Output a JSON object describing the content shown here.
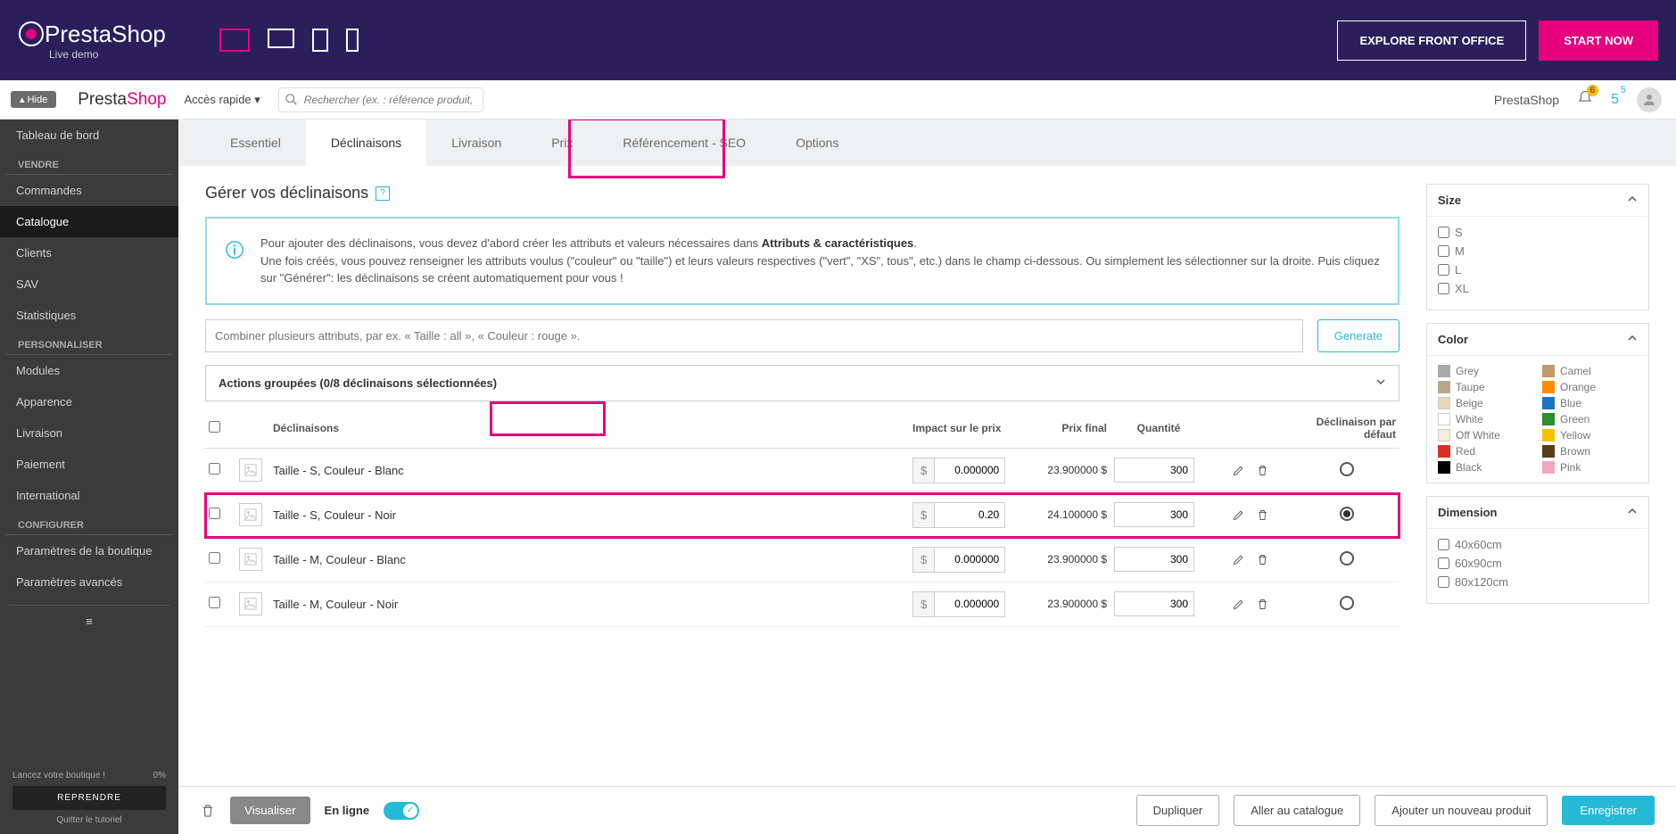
{
  "top_bar": {
    "logo_text": "PrestaShop",
    "logo_sub": "Live demo",
    "explore_btn": "EXPLORE FRONT OFFICE",
    "start_btn": "START NOW"
  },
  "header": {
    "hide": "Hide",
    "brand_presta": "Presta",
    "brand_shop": "Shop",
    "quick_access": "Accès rapide",
    "search_placeholder": "Rechercher (ex. : référence produit, nom...)",
    "shop_name": "PrestaShop",
    "notif_count": "6",
    "msg_count": "5"
  },
  "sidebar": {
    "dashboard": "Tableau de bord",
    "sections": {
      "vendre": "VENDRE",
      "personnaliser": "PERSONNALISER",
      "configurer": "CONFIGURER"
    },
    "items": {
      "commandes": "Commandes",
      "catalogue": "Catalogue",
      "clients": "Clients",
      "sav": "SAV",
      "statistiques": "Statistiques",
      "modules": "Modules",
      "apparence": "Apparence",
      "livraison": "Livraison",
      "paiement": "Paiement",
      "international": "International",
      "params_boutique": "Paramètres de la boutique",
      "params_avances": "Paramètres avancés"
    },
    "footer": {
      "launch": "Lancez votre boutique !",
      "pct": "0%",
      "reprendre": "REPRENDRE",
      "quit": "Quitter le tutoriel"
    }
  },
  "tabs": {
    "essentiel": "Essentiel",
    "declinaisons": "Déclinaisons",
    "livraison": "Livraison",
    "prix": "Prix",
    "seo": "Référencement - SEO",
    "options": "Options"
  },
  "content": {
    "title": "Gérer vos déclinaisons",
    "help": "?",
    "info": {
      "line1a": "Pour ajouter des déclinaisons, vous devez d'abord créer les attributs et valeurs nécessaires dans ",
      "line1b": "Attributs & caractéristiques",
      "line2": "Une fois créés, vous pouvez renseigner les attributs voulus (\"couleur\" ou \"taille\") et leurs valeurs respectives (\"vert\", \"XS\", tous\", etc.) dans le champ ci-dessous. Ou simplement les sélectionner sur la droite. Puis cliquez sur \"Générer\": les déclinaisons se créent automatiquement pour vous !"
    },
    "combine_placeholder": "Combiner plusieurs attributs, par ex. « Taille : all », « Couleur : rouge ».",
    "generate_btn": "Generate",
    "grouped_actions": "Actions groupées (0/8 déclinaisons sélectionnées)",
    "columns": {
      "declinaisons": "Déclinaisons",
      "impact": "Impact sur le prix",
      "prix_final": "Prix final",
      "quantite": "Quantité",
      "default": "Déclinaison par défaut"
    },
    "rows": [
      {
        "name": "Taille - S, Couleur - Blanc",
        "impact": "0.000000",
        "final": "23.900000 $",
        "qty": "300",
        "default": false
      },
      {
        "name": "Taille - S, Couleur - Noir",
        "impact": "0.20",
        "final": "24.100000 $",
        "qty": "300",
        "default": true
      },
      {
        "name": "Taille - M, Couleur - Blanc",
        "impact": "0.000000",
        "final": "23.900000 $",
        "qty": "300",
        "default": false
      },
      {
        "name": "Taille - M, Couleur - Noir",
        "impact": "0.000000",
        "final": "23.900000 $",
        "qty": "300",
        "default": false
      }
    ],
    "currency": "$"
  },
  "filters": {
    "size": {
      "title": "Size",
      "options": [
        "S",
        "M",
        "L",
        "XL"
      ]
    },
    "color": {
      "title": "Color",
      "options": [
        {
          "name": "Grey",
          "hex": "#aaa"
        },
        {
          "name": "Camel",
          "hex": "#c19a6b"
        },
        {
          "name": "Taupe",
          "hex": "#b8a88a"
        },
        {
          "name": "Orange",
          "hex": "#ff8c00"
        },
        {
          "name": "Beige",
          "hex": "#e8d9b5"
        },
        {
          "name": "Blue",
          "hex": "#1e73be"
        },
        {
          "name": "White",
          "hex": "#fff"
        },
        {
          "name": "Green",
          "hex": "#2e8b2e"
        },
        {
          "name": "Off White",
          "hex": "#f5ecd9"
        },
        {
          "name": "Yellow",
          "hex": "#f2c200"
        },
        {
          "name": "Red",
          "hex": "#d93025"
        },
        {
          "name": "Brown",
          "hex": "#5c3a1a"
        },
        {
          "name": "Black",
          "hex": "#000"
        },
        {
          "name": "Pink",
          "hex": "#f2a6c4"
        }
      ]
    },
    "dimension": {
      "title": "Dimension",
      "options": [
        "40x60cm",
        "60x90cm",
        "80x120cm"
      ]
    }
  },
  "footer": {
    "visualiser": "Visualiser",
    "en_ligne": "En ligne",
    "dupliquer": "Dupliquer",
    "aller": "Aller au catalogue",
    "ajouter": "Ajouter un nouveau produit",
    "enregistrer": "Enregistrer"
  }
}
